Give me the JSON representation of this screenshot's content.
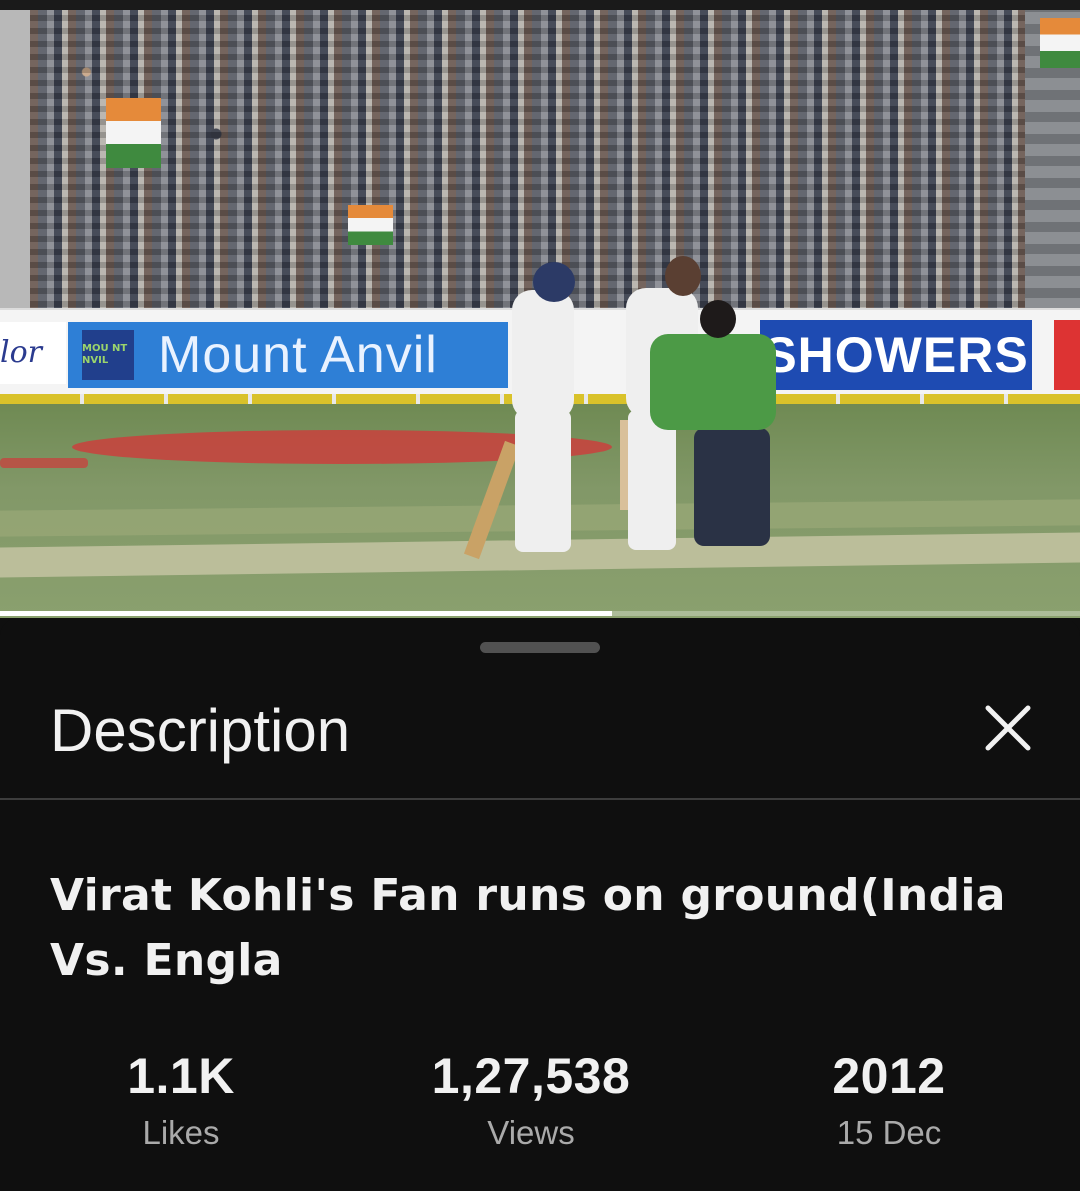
{
  "video": {
    "banner_left": "lor",
    "banner_logo": "MOU NT NVIL",
    "banner_main": "Mount Anvil",
    "banner_right": "SHOWERS",
    "progress_fraction": 0.567
  },
  "sheet": {
    "title": "Description",
    "close_icon": "close-icon",
    "video_title": "Virat Kohli's Fan runs on ground(India Vs. Engla",
    "stats": {
      "likes_value": "1.1K",
      "likes_label": "Likes",
      "views_value": "1,27,538",
      "views_label": "Views",
      "year_value": "2012",
      "date_label": "15 Dec"
    }
  },
  "colors": {
    "sheet_background": "#0f0f0f",
    "secondary_text": "#aaaaaa",
    "handle": "#515151"
  }
}
